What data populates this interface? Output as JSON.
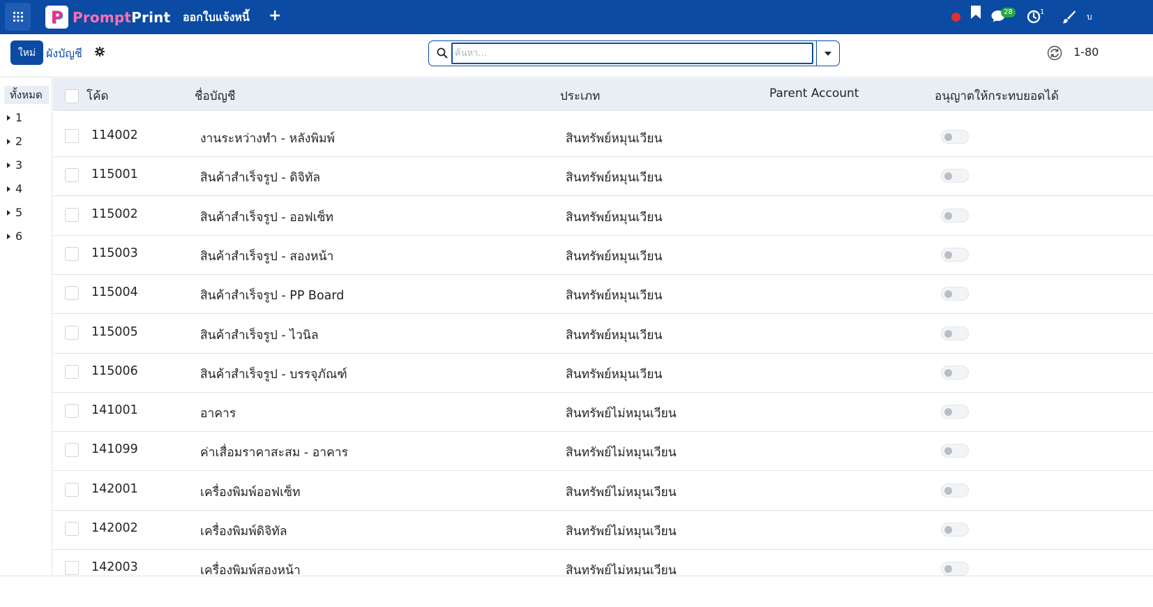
{
  "navbar": {
    "brand_initial": "P",
    "brand_prompt": "Prompt",
    "brand_print": "Print",
    "menu_title": "ออกใบแจ้งหนี้",
    "add_label": "+",
    "chat_count": "28",
    "activity_count": "1",
    "user_initial": "บ",
    "colors": {
      "navbar_bg": "#0b4ba3",
      "record_dot": "#e03131",
      "chat_badge": "#28a745"
    }
  },
  "control": {
    "new_button": "ใหม่",
    "breadcrumb": "ผังบัญชี",
    "search_placeholder": "ค้นหา...",
    "pager": "1-80"
  },
  "sidepanel": {
    "all_label": "ทั้งหมด",
    "groups": [
      "1",
      "2",
      "3",
      "4",
      "5",
      "6"
    ]
  },
  "table": {
    "columns": {
      "code": "โค้ด",
      "name": "ชื่อบัญชี",
      "type": "ประเภท",
      "parent": "Parent Account",
      "reconcile": "อนุญาตให้กระทบยอดได้"
    },
    "rows": [
      {
        "code": "114002",
        "name": "งานระหว่างทำ - หลังพิมพ์",
        "type": "สินทรัพย์หมุนเวียน",
        "parent": "",
        "reconcile": false
      },
      {
        "code": "115001",
        "name": "สินค้าสำเร็จรูป - ดิจิทัล",
        "type": "สินทรัพย์หมุนเวียน",
        "parent": "",
        "reconcile": false
      },
      {
        "code": "115002",
        "name": "สินค้าสำเร็จรูป - ออฟเซ็ท",
        "type": "สินทรัพย์หมุนเวียน",
        "parent": "",
        "reconcile": false
      },
      {
        "code": "115003",
        "name": "สินค้าสำเร็จรูป - สองหน้า",
        "type": "สินทรัพย์หมุนเวียน",
        "parent": "",
        "reconcile": false
      },
      {
        "code": "115004",
        "name": "สินค้าสำเร็จรูป - PP Board",
        "type": "สินทรัพย์หมุนเวียน",
        "parent": "",
        "reconcile": false
      },
      {
        "code": "115005",
        "name": "สินค้าสำเร็จรูป - ไวนิล",
        "type": "สินทรัพย์หมุนเวียน",
        "parent": "",
        "reconcile": false
      },
      {
        "code": "115006",
        "name": "สินค้าสำเร็จรูป - บรรจุภัณฑ์",
        "type": "สินทรัพย์หมุนเวียน",
        "parent": "",
        "reconcile": false
      },
      {
        "code": "141001",
        "name": "อาคาร",
        "type": "สินทรัพย์ไม่หมุนเวียน",
        "parent": "",
        "reconcile": false
      },
      {
        "code": "141099",
        "name": "ค่าเสื่อมราคาสะสม - อาคาร",
        "type": "สินทรัพย์ไม่หมุนเวียน",
        "parent": "",
        "reconcile": false
      },
      {
        "code": "142001",
        "name": "เครื่องพิมพ์ออฟเซ็ท",
        "type": "สินทรัพย์ไม่หมุนเวียน",
        "parent": "",
        "reconcile": false
      },
      {
        "code": "142002",
        "name": "เครื่องพิมพ์ดิจิทัล",
        "type": "สินทรัพย์ไม่หมุนเวียน",
        "parent": "",
        "reconcile": false
      },
      {
        "code": "142003",
        "name": "เครื่องพิมพ์สองหน้า",
        "type": "สินทรัพย์ไม่หมุนเวียน",
        "parent": "",
        "reconcile": false
      }
    ]
  }
}
